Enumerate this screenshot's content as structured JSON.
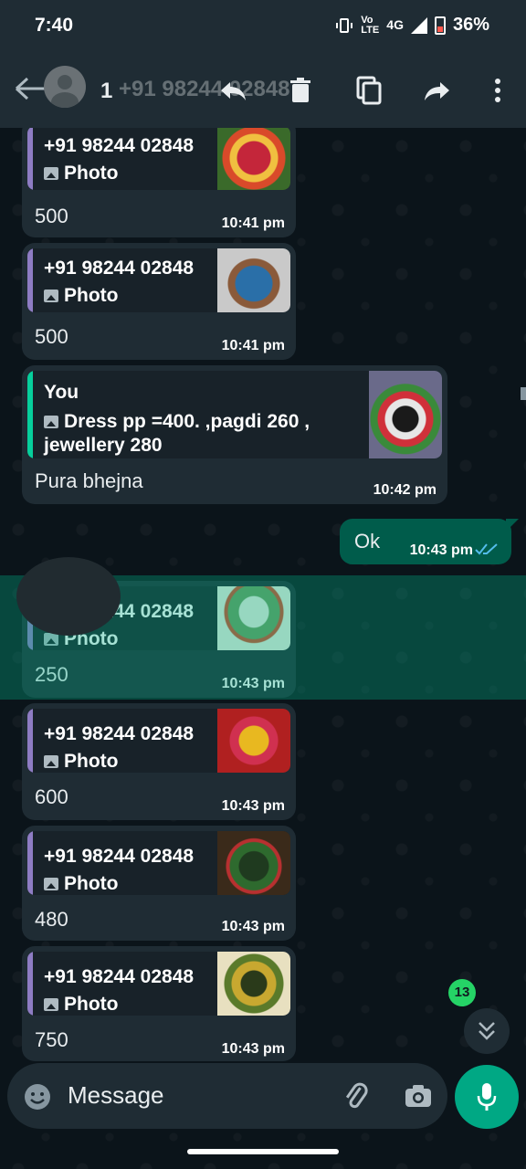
{
  "status": {
    "time": "7:40",
    "network_small": "Vo LTE",
    "network": "4G",
    "battery": "36%"
  },
  "appbar": {
    "selected_count": "1",
    "title": "+91 98244 02848",
    "icons": [
      "back-arrow-icon",
      "avatar-icon",
      "reply-icon",
      "delete-icon",
      "copy-icon",
      "forward-icon",
      "more-icon"
    ]
  },
  "messages": [
    {
      "quoted_sender": "+91 98244 02848",
      "quoted_text": "Photo",
      "text": "500",
      "time": "10:41 pm"
    },
    {
      "quoted_sender": "+91 98244 02848",
      "quoted_text": "Photo",
      "text": "500",
      "time": "10:41 pm"
    },
    {
      "quoted_sender": "You",
      "quoted_text": "Dress pp =400.  ,pagdi 260 ,",
      "quoted_text2": "jewellery 280",
      "text": "Pura bhejna",
      "time": "10:42 pm"
    },
    {
      "text": "Ok",
      "time": "10:43 pm",
      "read": true
    },
    {
      "quoted_sender": "+91 98244 02848",
      "quoted_text": "Photo",
      "text": "250",
      "time": "10:43 pm"
    },
    {
      "quoted_sender": "+91 98244 02848",
      "quoted_text": "Photo",
      "text": "600",
      "time": "10:43 pm"
    },
    {
      "quoted_sender": "+91 98244 02848",
      "quoted_text": "Photo",
      "text": "480",
      "time": "10:43 pm"
    },
    {
      "quoted_sender": "+91 98244 02848",
      "quoted_text": "Photo",
      "text": "750",
      "time": "10:43 pm"
    }
  ],
  "unread_count": "13",
  "composer": {
    "placeholder": "Message"
  },
  "colors": {
    "bg": "#0b141a",
    "bar": "#1f2c34",
    "incoming": "#1f2c34",
    "outgoing": "#005c4b",
    "accent": "#00a884",
    "quote_bar": "#8e7cc3",
    "quote_you": "#06cf9c",
    "read_ticks": "#53bdeb"
  }
}
